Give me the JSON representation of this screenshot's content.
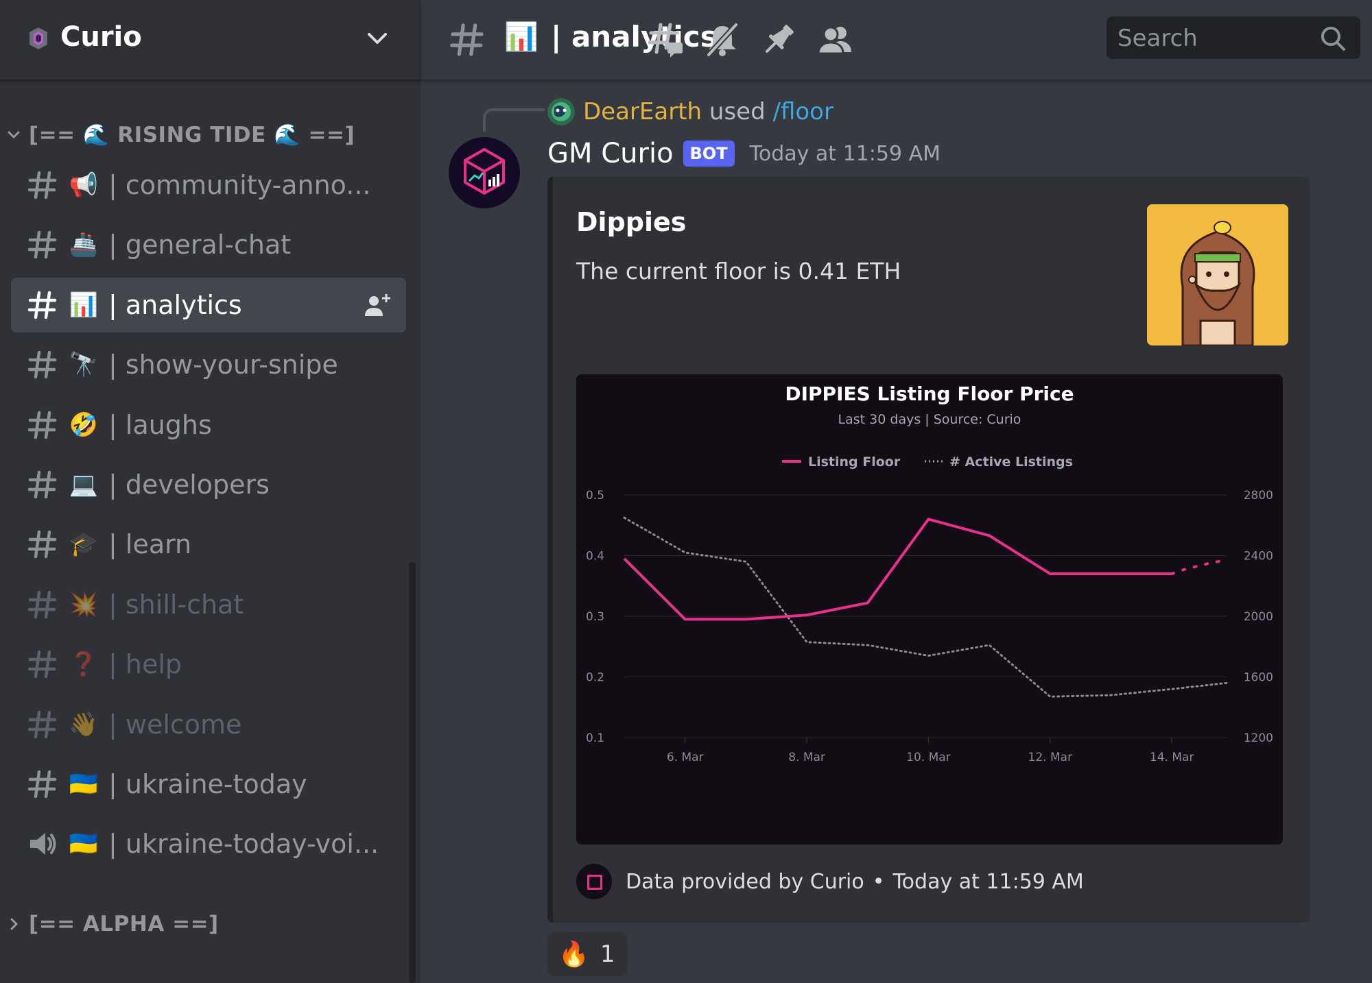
{
  "server": {
    "name": "Curio"
  },
  "categories": [
    {
      "label": "[== 🌊 RISING TIDE 🌊 ==]",
      "expanded": true
    },
    {
      "label": "[== ALPHA ==]",
      "expanded": false
    }
  ],
  "channels": [
    {
      "emoji": "📢",
      "name": "| community-anno...",
      "type": "text",
      "state": "normal"
    },
    {
      "emoji": "🚢",
      "name": "| general-chat",
      "type": "text",
      "state": "normal"
    },
    {
      "emoji": "📊",
      "name": "| analytics",
      "type": "text",
      "state": "active"
    },
    {
      "emoji": "🔭",
      "name": "| show-your-snipe",
      "type": "text",
      "state": "normal"
    },
    {
      "emoji": "🤣",
      "name": "| laughs",
      "type": "text",
      "state": "normal"
    },
    {
      "emoji": "💻",
      "name": "| developers",
      "type": "text",
      "state": "normal"
    },
    {
      "emoji": "🎓",
      "name": "| learn",
      "type": "text",
      "state": "normal"
    },
    {
      "emoji": "💥",
      "name": "| shill-chat",
      "type": "text",
      "state": "muted"
    },
    {
      "emoji": "❓",
      "name": "| help",
      "type": "text",
      "state": "muted"
    },
    {
      "emoji": "👋",
      "name": "| welcome",
      "type": "text",
      "state": "muted"
    },
    {
      "emoji": "🇺🇦",
      "name": "| ukraine-today",
      "type": "text",
      "state": "normal"
    },
    {
      "emoji": "🇺🇦",
      "name": "| ukraine-today-voi...",
      "type": "voice",
      "state": "normal"
    }
  ],
  "header": {
    "channel_emoji": "📊",
    "channel_name": "| analytics",
    "search_placeholder": "Search",
    "icons": [
      "threads-icon",
      "mute-icon",
      "pin-icon",
      "members-icon"
    ]
  },
  "message": {
    "reply": {
      "user": "DearEarth",
      "used": "used",
      "command": "/floor"
    },
    "author": "GM Curio",
    "bot_tag": "BOT",
    "timestamp": "Today at 11:59 AM",
    "embed": {
      "title": "Dippies",
      "description": "The current floor is 0.41 ETH",
      "footer_text": "Data provided by Curio",
      "footer_time": "Today at 11:59 AM"
    },
    "reaction": {
      "emoji": "🔥",
      "count": "1"
    }
  },
  "colors": {
    "floor": "#e8308c",
    "listings": "#8a8a8a",
    "bot_tag": "#5865f2",
    "reply_user": "#e3b341",
    "command": "#3ea6e0"
  },
  "chart_data": {
    "type": "line",
    "title": "DIPPIES Listing Floor Price",
    "subtitle": "Last 30 days | Source: Curio",
    "x_ticks": [
      "6. Mar",
      "8. Mar",
      "10. Mar",
      "12. Mar",
      "14. Mar"
    ],
    "x_range": [
      5,
      14.9
    ],
    "y_left_ticks": [
      "0.1",
      "0.2",
      "0.3",
      "0.4",
      "0.5"
    ],
    "y_left_range": [
      0.1,
      0.5
    ],
    "y_right_ticks": [
      "1200",
      "1600",
      "2000",
      "2400",
      "2800"
    ],
    "y_right_range": [
      1200,
      2800
    ],
    "legend_position": "top-center",
    "grid": true,
    "series": [
      {
        "name": "Listing Floor",
        "axis": "left",
        "style": "solid",
        "x": [
          5,
          6,
          7,
          8,
          9,
          10,
          11,
          12,
          13,
          14
        ],
        "y": [
          0.395,
          0.295,
          0.295,
          0.302,
          0.322,
          0.46,
          0.433,
          0.37,
          0.37,
          0.37
        ],
        "projection": {
          "x": [
            14,
            14.2,
            14.4,
            14.6,
            14.9
          ],
          "y": [
            0.37,
            0.377,
            0.382,
            0.387,
            0.393
          ]
        }
      },
      {
        "name": "# Active Listings",
        "axis": "right",
        "style": "dotted",
        "x": [
          5,
          6,
          7,
          8,
          9,
          10,
          11,
          12,
          13,
          14,
          14.9
        ],
        "y": [
          2650,
          2420,
          2360,
          1830,
          1810,
          1740,
          1810,
          1470,
          1480,
          1520,
          1560
        ]
      }
    ]
  }
}
